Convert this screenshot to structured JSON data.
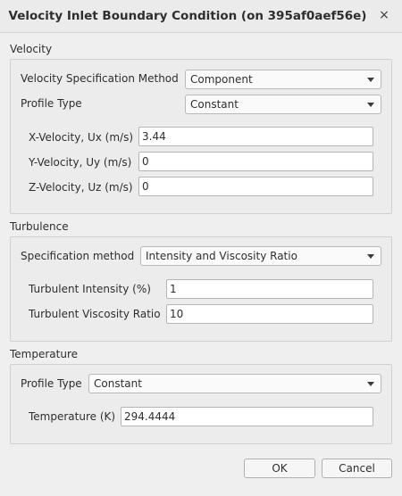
{
  "window": {
    "title": "Velocity Inlet Boundary Condition (on 395af0aef56e)",
    "close_glyph": "×"
  },
  "velocity": {
    "section_title": "Velocity",
    "spec_method_label": "Velocity Specification Method",
    "spec_method_value": "Component",
    "profile_type_label": "Profile Type",
    "profile_type_value": "Constant",
    "ux_label": "X-Velocity, Ux (m/s)",
    "ux_value": "3.44",
    "uy_label": "Y-Velocity, Uy (m/s)",
    "uy_value": "0",
    "uz_label": "Z-Velocity, Uz (m/s)",
    "uz_value": "0"
  },
  "turbulence": {
    "section_title": "Turbulence",
    "spec_method_label": "Specification method",
    "spec_method_value": "Intensity and Viscosity Ratio",
    "intensity_label": "Turbulent Intensity (%)",
    "intensity_value": "1",
    "viscosity_ratio_label": "Turbulent Viscosity Ratio",
    "viscosity_ratio_value": "10"
  },
  "temperature": {
    "section_title": "Temperature",
    "profile_type_label": "Profile Type",
    "profile_type_value": "Constant",
    "temperature_label": "Temperature (K)",
    "temperature_value": "294.4444"
  },
  "buttons": {
    "ok_label": "OK",
    "cancel_label": "Cancel"
  }
}
